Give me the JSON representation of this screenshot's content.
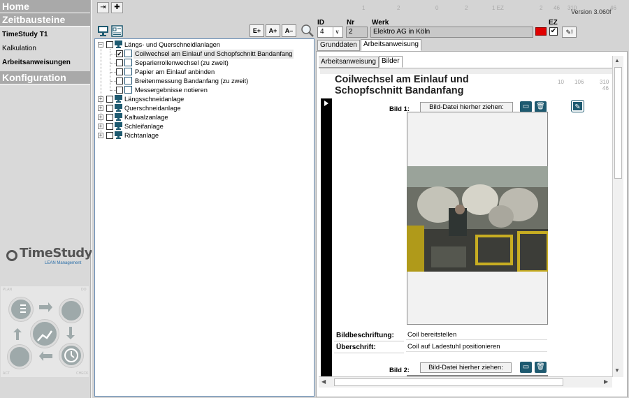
{
  "sidebar": {
    "home": "Home",
    "zeitbausteine": "Zeitbausteine",
    "items": [
      "TimeStudy T1",
      "Kalkulation",
      "Arbeitsanweisungen"
    ],
    "konfiguration": "Konfiguration",
    "logo_text": "TimeStudy",
    "logo_sub": "LEAN Management",
    "cycle_labels": [
      "PLAN",
      "DO",
      "CHECK",
      "ACT"
    ]
  },
  "topbar": {
    "faint_numbers": [
      "1",
      "2",
      "0",
      "2",
      "1 EZ",
      "2",
      "46",
      "310",
      "46"
    ],
    "version": "Version 3.060f"
  },
  "tree": {
    "root": "Längs- und Querschneidlanlagen",
    "children": [
      {
        "label": "Coilwechsel am Einlauf und Schopfschnitt Bandanfang",
        "checked": true
      },
      {
        "label": "Separierrollenwechsel (zu zweit)",
        "checked": false
      },
      {
        "label": "Papier am Einlauf anbinden",
        "checked": false
      },
      {
        "label": "Breitenmessung Bandanfang (zu zweit)",
        "checked": false
      },
      {
        "label": "Messergebnisse notieren",
        "checked": false
      }
    ],
    "groups": [
      "Längsschneidanlage",
      "Querschneidanlage",
      "Kaltwalzanlage",
      "Schleifanlage",
      "Richtanlage"
    ],
    "font_buttons": [
      "E+",
      "A+",
      "A–"
    ]
  },
  "header": {
    "id_label": "ID",
    "id_value": "4",
    "nr_label": "Nr",
    "nr_value": "2",
    "werk_label": "Werk",
    "werk_value": "Elektro AG in Köln",
    "ez_label": "EZ",
    "status_color": "#e00000"
  },
  "tabs": {
    "outer": [
      "Grunddaten",
      "Arbeitsanweisung"
    ],
    "inner": [
      "Arbeitsanweisung",
      "Bilder"
    ]
  },
  "content": {
    "title": "Coilwechsel am Einlauf und Schopfschnitt Bandanfang",
    "faint_numbers": [
      "10",
      "106",
      "310",
      "46"
    ],
    "bild1_label": "Bild 1:",
    "drop_text": "Bild-Datei hierher ziehen:",
    "bildbeschriftung_label": "Bildbeschriftung:",
    "bildbeschriftung_value": "Coil bereitstellen",
    "ueberschrift_label": "Überschrift:",
    "ueberschrift_value": "Coil auf Ladestuhl positionieren",
    "bild2_label": "Bild 2:",
    "drop_text2": "Bild-Datei hierher ziehen:"
  }
}
